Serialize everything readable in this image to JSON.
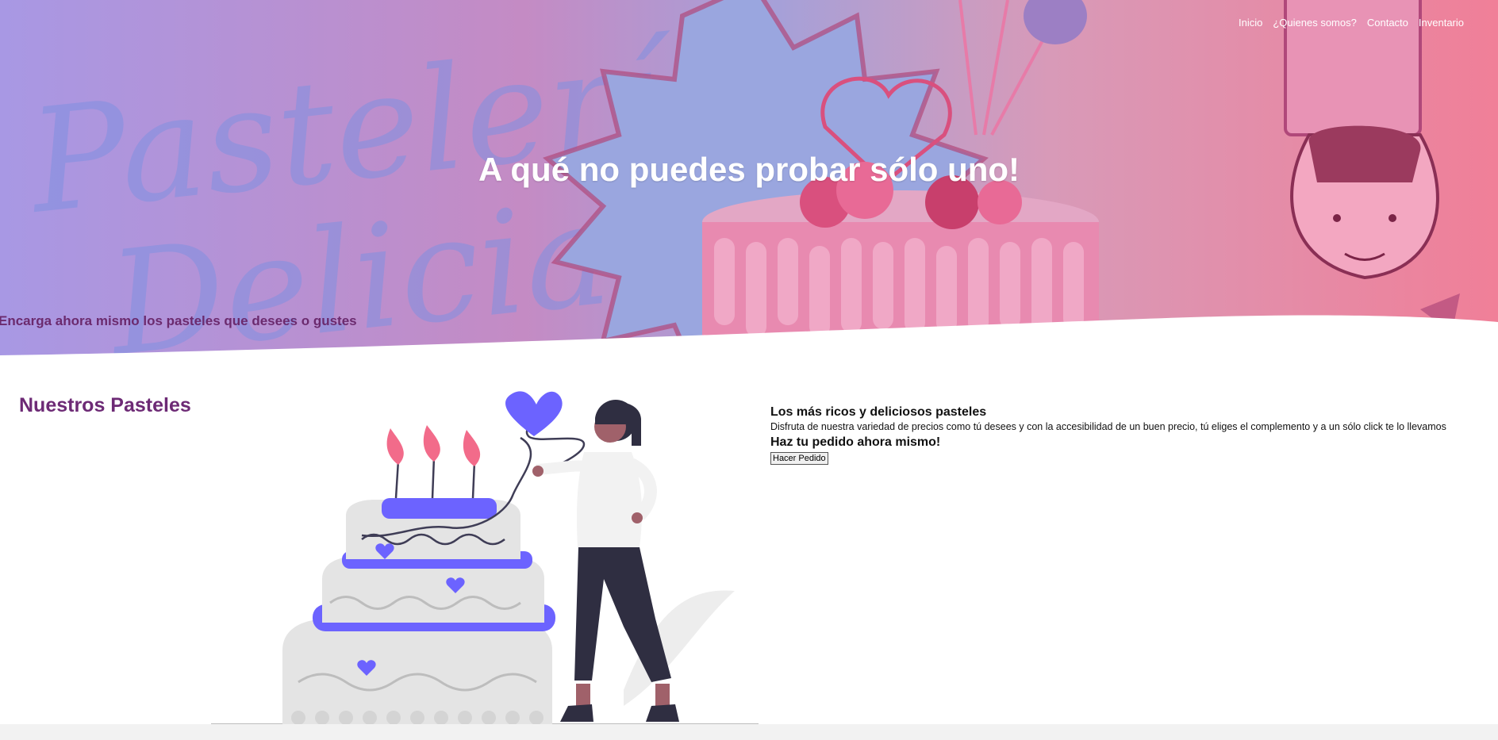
{
  "nav": {
    "items": [
      {
        "label": "Inicio"
      },
      {
        "label": "¿Quienes somos?"
      },
      {
        "label": "Contacto"
      },
      {
        "label": "Inventario"
      }
    ]
  },
  "hero": {
    "title": "A qué no puedes probar sólo uno!",
    "subtitle": "Encarga ahora mismo los pasteles que desees o gustes",
    "background_script_text": "Pastelería Delicias"
  },
  "section": {
    "title": "Nuestros Pasteles"
  },
  "info": {
    "heading": "Los más ricos y deliciosos pasteles",
    "body": "Disfruta de nuestra variedad de precios como tú desees y con la accesibilidad de un buen precio, tú eliges el complemento y a un sólo click te lo llevamos",
    "cta_heading": "Haz tu pedido ahora mismo!",
    "button_label": "Hacer Pedido"
  },
  "colors": {
    "accent_purple": "#6c63ff",
    "title_purple": "#6d2a75",
    "hero_pink": "#f07f98"
  }
}
